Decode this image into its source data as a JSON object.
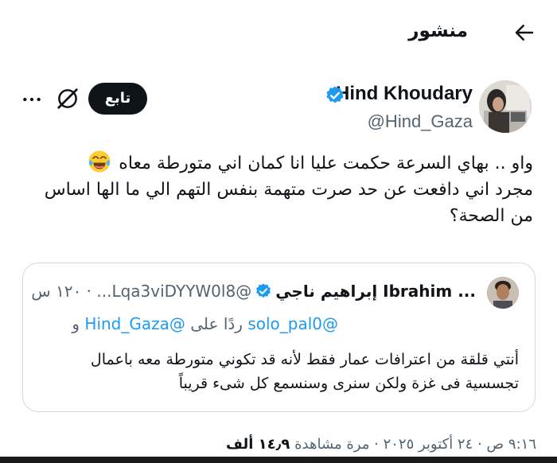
{
  "header": {
    "title": "منشور"
  },
  "author": {
    "display_name": "Hind Khoudary",
    "handle": "@Hind_Gaza",
    "follow_label": "تابع"
  },
  "post": {
    "lines": [
      "واو .. بهاي السرعة حكمت عليا انا كمان اني متورطة معاه",
      "مجرد اني دافعت عن حد صرت متهمة بنفس التهم الي ما الها اساس",
      "من الصحة؟"
    ],
    "emoji": "😂"
  },
  "quote": {
    "display_name": "... Ibrahim إبراهيم ناجي",
    "handle": "@Lqa3viDYYW0l8...",
    "time": "· ١٢٠ س",
    "reply_prefix": "ردًا على",
    "reply_mention_1": "@solo_pal0",
    "reply_mention_2": "@Hind_Gaza",
    "reply_and": "و",
    "lines": [
      "أنتي قلقة من اعترافات عمار فقط لأنه قد تكوني متورطة معه باعمال",
      "تجسسية فى غزة ولكن سنرى وسنسمع كل شىء قريباً"
    ]
  },
  "meta": {
    "time_date": "٩:١٦ ص · ٢٤ أكتوبر ٢٠٢٥ ·",
    "views_count": "١٤٫٩ ألف",
    "views_label": "مرة مشاهدة"
  },
  "colors": {
    "text": "#0f1419",
    "secondary": "#536471",
    "verified": "#1d9bf0",
    "follow_bg": "#0f1419",
    "border": "#cfd9de"
  },
  "icons": [
    "back-arrow-icon",
    "verified-badge-icon",
    "grok-icon",
    "more-icon",
    "laughing-emoji-icon"
  ]
}
